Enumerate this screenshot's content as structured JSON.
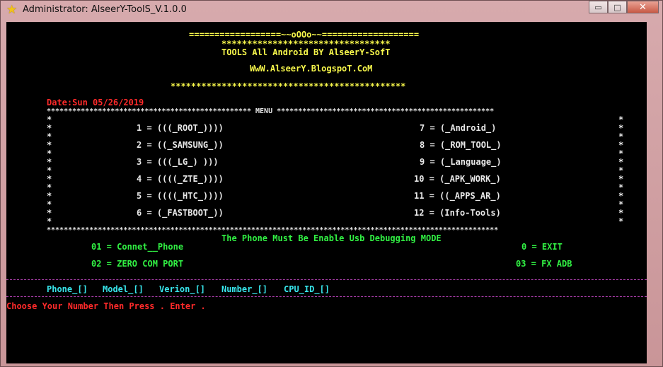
{
  "window": {
    "title": "Administrator: AlseerY-ToolS_V.1.0.0",
    "icon": "star-icon",
    "controls": {
      "minimize": "▭",
      "maximize": "□",
      "close": "✕"
    }
  },
  "header": {
    "banner_line": "==================~~oOOo~~===================",
    "stars_line": "*********************************",
    "title": "TOOLS All Android BY AlseerY-SofT",
    "website": "WwW.AlseerY.BlogspoT.CoM",
    "stars_line2": "**********************************************"
  },
  "date": "Date:Sun 05/26/2019",
  "menu": {
    "top_border": "************************************************ MENU ***************************************************",
    "bottom_border": "**********************************************************************************************************",
    "side_char": "*",
    "left_items": [
      "1 = (((_ROOT_))))",
      "2 = ((_SAMSUNG_))",
      "3 = (((_LG_) )))",
      "4 = ((((_ZTE_))))",
      "5 = ((((_HTC_))))",
      "6 = (_FASTBOOT_))"
    ],
    "right_items": [
      "7 = (_Android_)",
      "8 = (_ROM_TOOL_)",
      "9 = (_Language_)",
      "10 = (_APK_WORK_)",
      "11 = ((_APPS_AR_)",
      "12 = (Info-Tools)"
    ]
  },
  "usb_notice": "The Phone Must Be Enable Usb Debugging MODE",
  "options": {
    "connect": "01 = Connet__Phone",
    "zero_com": "02 = ZERO COM PORT",
    "exit": "0 = EXIT",
    "fix_adb": "03 = FX ADB"
  },
  "status": {
    "phone": "Phone_[]",
    "model": "Model_[]",
    "version": "Verion_[]",
    "number": "Number_[]",
    "cpu": "CPU_ID_[]"
  },
  "prompt": "Choose Your Number Then Press . Enter ."
}
